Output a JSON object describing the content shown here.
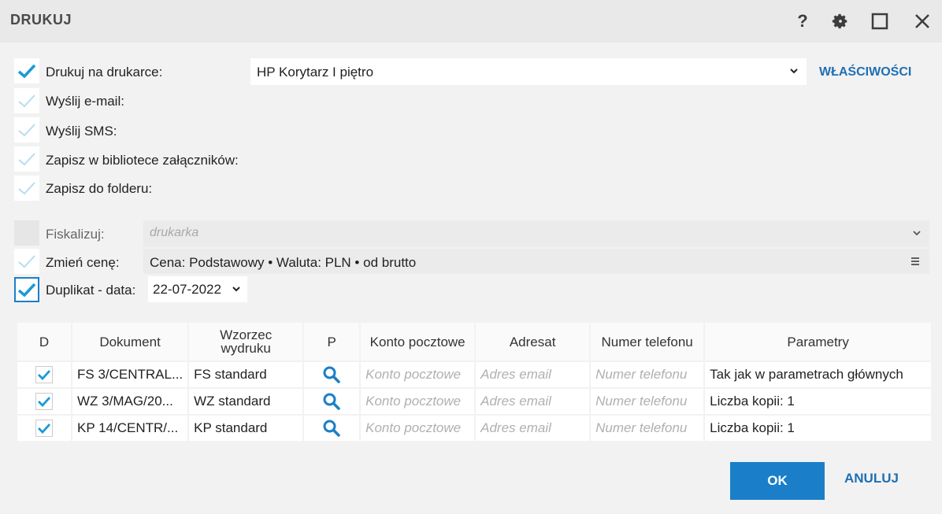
{
  "window": {
    "title": "DRUKUJ"
  },
  "options": {
    "print_label": "Drukuj na drukarce:",
    "email_label": "Wyślij e-mail:",
    "sms_label": "Wyślij SMS:",
    "library_label": "Zapisz w bibliotece załączników:",
    "folder_label": "Zapisz do folderu:",
    "fiscal_label": "Fiskalizuj:",
    "price_label": "Zmień cenę:",
    "duplicate_label": "Duplikat - data:"
  },
  "printer": {
    "value": "HP Korytarz I piętro",
    "properties_label": "WŁAŚCIWOŚCI"
  },
  "fiscal": {
    "placeholder": "drukarka"
  },
  "price": {
    "value": "Cena: Podstawowy • Waluta: PLN • od brutto"
  },
  "duplicate": {
    "date": "22-07-2022"
  },
  "table": {
    "headers": [
      "D",
      "Dokument",
      "Wzorzec wydruku",
      "P",
      "Konto pocztowe",
      "Adresat",
      "Numer telefonu",
      "Parametry"
    ],
    "rows": [
      {
        "document": "FS 3/CENTRAL...",
        "template": "FS standard",
        "account": "Konto pocztowe",
        "recipient": "Adres email",
        "phone": "Numer telefonu",
        "params": "Tak jak w parametrach głównych"
      },
      {
        "document": "WZ 3/MAG/20...",
        "template": "WZ standard",
        "account": "Konto pocztowe",
        "recipient": "Adres email",
        "phone": "Numer telefonu",
        "params": "Liczba kopii: 1"
      },
      {
        "document": "KP 14/CENTR/...",
        "template": "KP standard",
        "account": "Konto pocztowe",
        "recipient": "Adres email",
        "phone": "Numer telefonu",
        "params": "Liczba kopii: 1"
      }
    ]
  },
  "buttons": {
    "ok": "OK",
    "cancel": "ANULUJ"
  },
  "icons": [
    "help-icon",
    "gear-icon",
    "maximize-icon",
    "close-icon",
    "check-icon",
    "chevron-down-icon",
    "menu-icon",
    "search-icon"
  ],
  "colors": {
    "accent": "#1a7fc8",
    "check": "#1a9ad6",
    "check_light": "#b8dcef"
  }
}
